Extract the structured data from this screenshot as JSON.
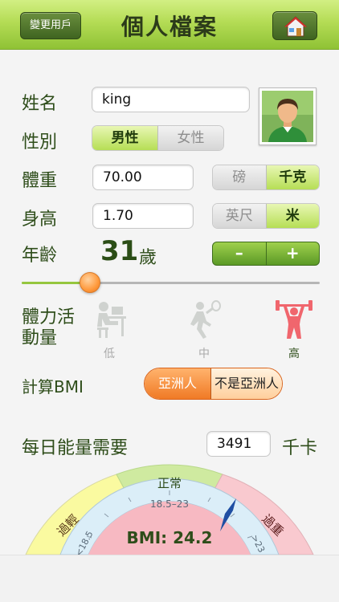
{
  "header": {
    "title": "個人檔案",
    "switch_user_label": "變更用戶",
    "home_icon": "home-icon"
  },
  "form": {
    "name_label": "姓名",
    "name_value": "king",
    "gender_label": "性別",
    "gender_options": [
      "男性",
      "女性"
    ],
    "gender_selected": "男性",
    "weight_label": "體重",
    "weight_value": "70.00",
    "weight_units": [
      "磅",
      "千克"
    ],
    "weight_unit_selected": "千克",
    "height_label": "身高",
    "height_value": "1.70",
    "height_units": [
      "英尺",
      "米"
    ],
    "height_unit_selected": "米",
    "age_label": "年齡",
    "age_value": "31",
    "age_unit": "歲",
    "stepper_minus": "–",
    "stepper_plus": "+",
    "age_slider_fraction": 0.23,
    "activity_label_line1": "體力活",
    "activity_label_line2": "動量",
    "activity_levels": [
      "低",
      "中",
      "高"
    ],
    "activity_selected": "高",
    "bmi_label": "計算BMI",
    "bmi_options": [
      "亞洲人",
      "不是亞洲人"
    ],
    "bmi_selected": "亞洲人",
    "energy_label": "每日能量需要",
    "energy_value": "3491",
    "energy_unit": "千卡"
  },
  "gauge": {
    "zone_low": "過輕",
    "zone_normal": "正常",
    "zone_high": "過重",
    "scale_low": "<18.5",
    "scale_normal": "18.5–23",
    "scale_high": ">23",
    "bmi_readout": "BMI: 24.2",
    "bmi_value": 24.2
  },
  "colors": {
    "header_green": "#b4dc55",
    "active_green": "#b6de55",
    "accent_orange": "#f07a25",
    "zone_yellow": "#fafaa0",
    "zone_green": "#cfeaa0",
    "zone_pink": "#f9c9cf"
  }
}
